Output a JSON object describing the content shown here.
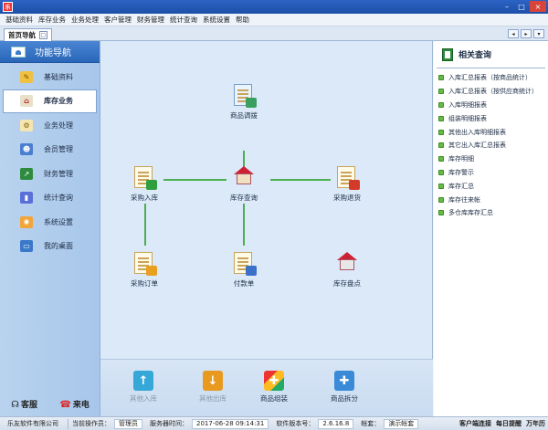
{
  "menu": [
    "基础资料",
    "库存业务",
    "业务处理",
    "客户管理",
    "财务管理",
    "统计查询",
    "系统设置",
    "帮助"
  ],
  "tab": {
    "label": "首页导航"
  },
  "sidebar": {
    "title": "功能导航",
    "items": [
      {
        "label": "基础资料",
        "icon": "pencil-icon"
      },
      {
        "label": "库存业务",
        "icon": "house-icon"
      },
      {
        "label": "业务处理",
        "icon": "gear-doc-icon"
      },
      {
        "label": "会员管理",
        "icon": "users-icon"
      },
      {
        "label": "财务管理",
        "icon": "finance-chart-icon"
      },
      {
        "label": "统计查询",
        "icon": "bar-chart-icon"
      },
      {
        "label": "系统设置",
        "icon": "settings-icon"
      },
      {
        "label": "我的桌面",
        "icon": "desktop-icon"
      }
    ],
    "footer": {
      "service": "客服",
      "call": "来电"
    }
  },
  "flow": {
    "goods_adjust": "商品调拨",
    "purchase_in": "采购入库",
    "stock_query": "库存查询",
    "purchase_return": "采购退货",
    "purchase_order": "采购订单",
    "payment": "付款单",
    "stocktake": "库存盘点"
  },
  "bottom": {
    "other_in": "其他入库",
    "other_out": "其他出库",
    "assemble": "商品组装",
    "split": "商品拆分"
  },
  "related": {
    "title": "相关查询",
    "items": [
      "入库汇总报表（按商品统计）",
      "入库汇总报表（按供应商统计）",
      "入库明细报表",
      "组装明细报表",
      "其他出入库明细报表",
      "其它出入库汇总报表",
      "库存明细",
      "库存警示",
      "库存汇总",
      "库存往来帐",
      "多仓库库存汇总"
    ]
  },
  "status": {
    "company": "乐友软件有限公司",
    "operator_label": "当前操作员：",
    "operator": "管理员",
    "server_time_label": "服务器时间：",
    "server_time": "2017-06-28 09:14:31",
    "version_label": "软件版本号：",
    "version": "2.6.16.8",
    "account_label": "帐套：",
    "account": "演示帐套",
    "client_conn": "客户端连接",
    "daily_remind": "每日提醒",
    "calendar": "万年历"
  }
}
